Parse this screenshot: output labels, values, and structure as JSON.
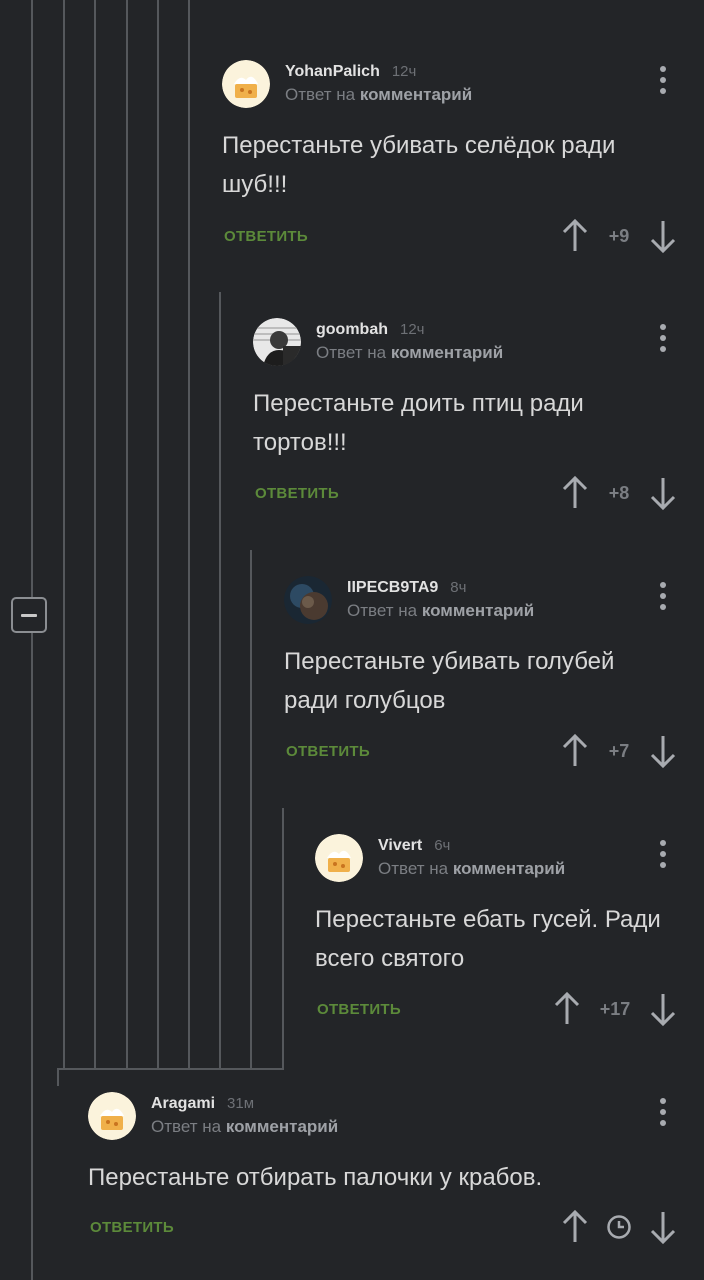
{
  "reply_label": "ОТВЕТИТЬ",
  "reply_prefix": "Ответ на",
  "reply_link": "комментарий",
  "comments": [
    {
      "user": "YohanPalich",
      "time": "12ч",
      "text": "Перестаньте убивать селёдок ради шуб!!!",
      "rating": "+9",
      "avatar": "default-cake-avatar"
    },
    {
      "user": "goombah",
      "time": "12ч",
      "text": "Перестаньте доить птиц ради тортов!!!",
      "rating": "+8",
      "avatar": "photo-avatar"
    },
    {
      "user": "IIPECB9TA9",
      "time": "8ч",
      "text": "Перестаньте убивать голубей ради голубцов",
      "rating": "+7",
      "avatar": "photo-avatar"
    },
    {
      "user": "Vivert",
      "time": "6ч",
      "text": "Перестаньте ебать гусей. Ради всего святого",
      "rating": "+17",
      "avatar": "default-cake-avatar"
    },
    {
      "user": "Aragami",
      "time": "31м",
      "text": "Перестаньте отбирать палочки у крабов.",
      "rating": "",
      "rating_icon": "clock-icon",
      "avatar": "default-cake-avatar"
    }
  ],
  "colors": {
    "background": "#232528",
    "thread_line": "#55585c",
    "reply_button": "#5c8a3a",
    "text": "#d8d8d8"
  }
}
